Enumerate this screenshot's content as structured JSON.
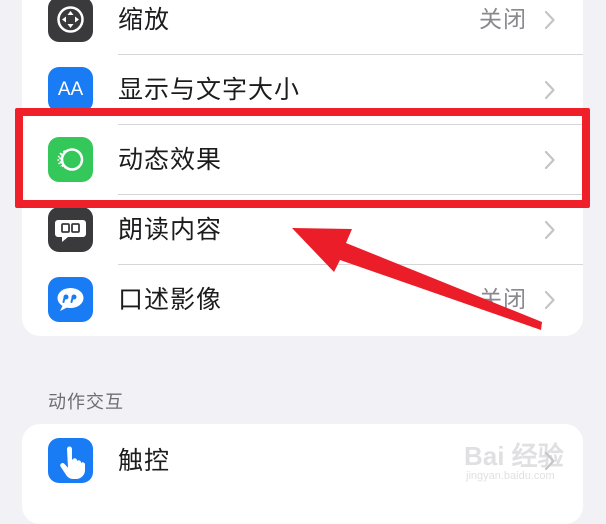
{
  "settings": {
    "zoom": {
      "label": "缩放",
      "value": "关闭",
      "icon": "zoom-icon"
    },
    "display_text_size": {
      "label": "显示与文字大小",
      "icon": "text-size-icon",
      "icon_text": "AA"
    },
    "motion": {
      "label": "动态效果",
      "icon": "motion-icon"
    },
    "spoken_content": {
      "label": "朗读内容",
      "icon": "speech-bubble-icon"
    },
    "audio_descriptions": {
      "label": "口述影像",
      "value": "关闭",
      "icon": "quote-bubble-icon"
    }
  },
  "section_interaction": {
    "header": "动作交互",
    "touch": {
      "label": "触控",
      "icon": "hand-icon"
    }
  },
  "annotation": {
    "highlight_color": "#f0202a",
    "highlighted_item": "动态效果"
  },
  "watermark": {
    "text": "Bai 经验",
    "sub": "jingyan.baidu.com"
  },
  "colors": {
    "background": "#f2f2f6",
    "icon_gray": "#3a3a3c",
    "icon_blue": "#1a7cf5",
    "icon_green": "#34c759",
    "chevron": "#c4c4c7"
  }
}
